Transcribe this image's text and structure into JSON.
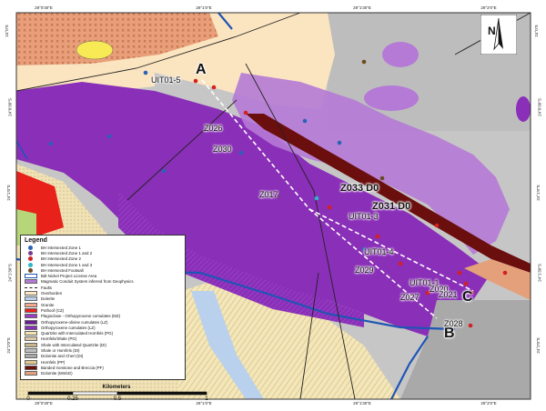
{
  "map": {
    "section_points": [
      "A",
      "B",
      "C"
    ],
    "drillhole_labels": [
      "UIT01-5",
      "Z026",
      "Z030",
      "Z017",
      "UIT01-3",
      "UIT01-4",
      "Z029",
      "UIT01-1",
      "Z020",
      "Z027",
      "Z021",
      "Z028"
    ],
    "zone_labels": [
      "Z033 D0",
      "Z031 D0"
    ]
  },
  "graticule": {
    "top": [
      "29°0'30\"E",
      "29°1'0\"E",
      "29°1'30\"E",
      "29°2'0\"E"
    ],
    "bottom": [
      "29°0'30\"E",
      "29°1'0\"E",
      "29°1'30\"E",
      "29°2'0\"E"
    ],
    "left": [
      "24°0'S",
      "24°0'30\"S",
      "24°1'0\"S",
      "24°1'30\"S",
      "24°2'0\"S"
    ],
    "right": [
      "24°0'S",
      "24°0'30\"S",
      "24°1'0\"S",
      "24°1'30\"S",
      "24°2'0\"S"
    ]
  },
  "north_arrow": {
    "label": "N"
  },
  "legend": {
    "title": "Legend",
    "items": [
      {
        "label": "BH Intersected Zone 1",
        "symbol": "dot",
        "color": "#2a62b8"
      },
      {
        "label": "BH Intersected Zone 1 and 2",
        "symbol": "dot",
        "color": "#7a3c8c"
      },
      {
        "label": "BH Intersected Zone 2",
        "symbol": "dot",
        "color": "#d42020"
      },
      {
        "label": "BH Intersected Zone 1 and 3",
        "symbol": "dot",
        "color": "#2bb5c6"
      },
      {
        "label": "BH Intersected Footwall",
        "symbol": "dot",
        "color": "#6b4a1e"
      },
      {
        "label": "Bdt Nickel Project License Area",
        "symbol": "outline",
        "color": "#1f55b5"
      },
      {
        "label": "Magmatic Conduit System inferred from Geophysics",
        "symbol": "fill",
        "color": "#b57ad6"
      },
      {
        "label": "Faults",
        "symbol": "dash",
        "color": "#222222"
      },
      {
        "label": "Overburden",
        "symbol": "fill",
        "color": "#fde8c4"
      },
      {
        "label": "Dolerite",
        "symbol": "fill",
        "color": "#b9d1ec"
      },
      {
        "label": "Granite",
        "symbol": "fill",
        "color": "#f2a98e"
      },
      {
        "label": "Pothoof (CZ)",
        "symbol": "fill",
        "color": "#e8211a"
      },
      {
        "label": "Plagioclase - Orthopyroxene cumulates (MZ)",
        "symbol": "fill",
        "color": "#9a3fc4"
      },
      {
        "label": "Orthopyroxene-olivine cumulates (LZ)",
        "symbol": "fill",
        "color": "#6a1c96"
      },
      {
        "label": "Orthopyroxene cumulates (LZ)",
        "symbol": "fill",
        "color": "#8a2fb8"
      },
      {
        "label": "Quartzite with Interculated Hornfels (PG)",
        "symbol": "fill",
        "color": "#f2e3b0"
      },
      {
        "label": "Hornfels/Shale (PG)",
        "symbol": "fill",
        "color": "#d9c9a6"
      },
      {
        "label": "Shale with Interculated Quartzite (DI)",
        "symbol": "fill",
        "color": "#c9b68e"
      },
      {
        "label": "Shale or Hornfels (DI)",
        "symbol": "fill",
        "color": "#bfbfbf"
      },
      {
        "label": "Dolomite and Chert (DI)",
        "symbol": "fill",
        "color": "#a9a9a9"
      },
      {
        "label": "Hornfels (PP)",
        "symbol": "fill",
        "color": "#e0c78c"
      },
      {
        "label": "Banded Ironstone and Breccia (PF)",
        "symbol": "fill",
        "color": "#6b0e0e"
      },
      {
        "label": "Dolomite (MmbG)",
        "symbol": "fill",
        "color": "#e4a07a"
      }
    ]
  },
  "scale_bar": {
    "title": "Kilometers",
    "ticks": [
      "0",
      "0.25",
      "0.5",
      "1"
    ],
    "tick_values": [
      0,
      0.25,
      0.5,
      1
    ],
    "max_km": 1
  }
}
